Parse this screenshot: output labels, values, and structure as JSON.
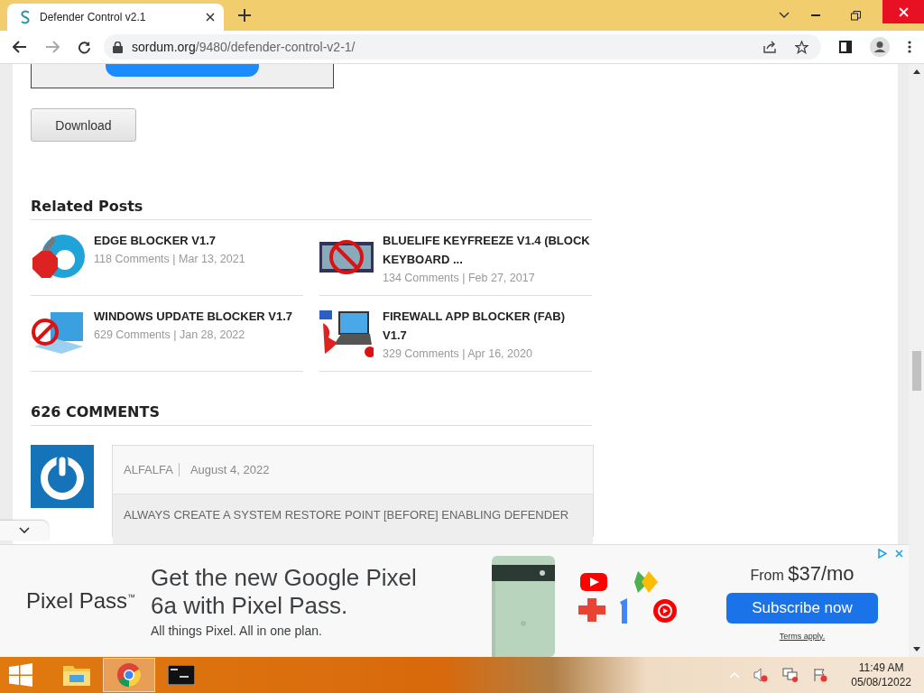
{
  "browser": {
    "tab": {
      "title": "Defender Control v2.1",
      "selected": true
    },
    "url_host": "sordum.org",
    "url_path": "/9480/defender-control-v2-1/"
  },
  "page": {
    "download_button": "Download",
    "related_title": "Related Posts",
    "related": [
      {
        "kind": "edge",
        "title": "EDGE BLOCKER V1.7",
        "meta": "118 Comments | Mar 13, 2021"
      },
      {
        "kind": "keyboard",
        "title": "BLUELIFE KEYFREEZE V1.4 (BLOCK KEYBOARD ...",
        "meta": "134 Comments | Feb 27, 2017"
      },
      {
        "kind": "windows",
        "title": "WINDOWS UPDATE BLOCKER V1.7",
        "meta": "629 Comments | Jan 28, 2022"
      },
      {
        "kind": "firewall",
        "title": "FIREWALL APP BLOCKER (FAB) V1.7",
        "meta": "329 Comments | Apr 16, 2020"
      }
    ],
    "comments_title": "626 COMMENTS",
    "comment": {
      "author": "ALFALFA",
      "date": "August 4, 2022",
      "text": "ALWAYS CREATE A SYSTEM RESTORE POINT [BEFORE] ENABLING DEFENDER"
    }
  },
  "ad": {
    "brand": "Pixel Pass",
    "trademark": "™",
    "headline": "Get the new Google Pixel 6a with Pixel Pass.",
    "subline": "All things Pixel. All in one plan.",
    "price_prefix": "From",
    "price": "$37/mo",
    "cta": "Subscribe now",
    "terms": "Terms apply."
  },
  "taskbar": {
    "apps": [
      {
        "kind": "explorer",
        "selected": false
      },
      {
        "kind": "chrome",
        "selected": true
      },
      {
        "kind": "console",
        "selected": false
      }
    ],
    "time": "11:49 AM",
    "date": "05/08/12022"
  }
}
